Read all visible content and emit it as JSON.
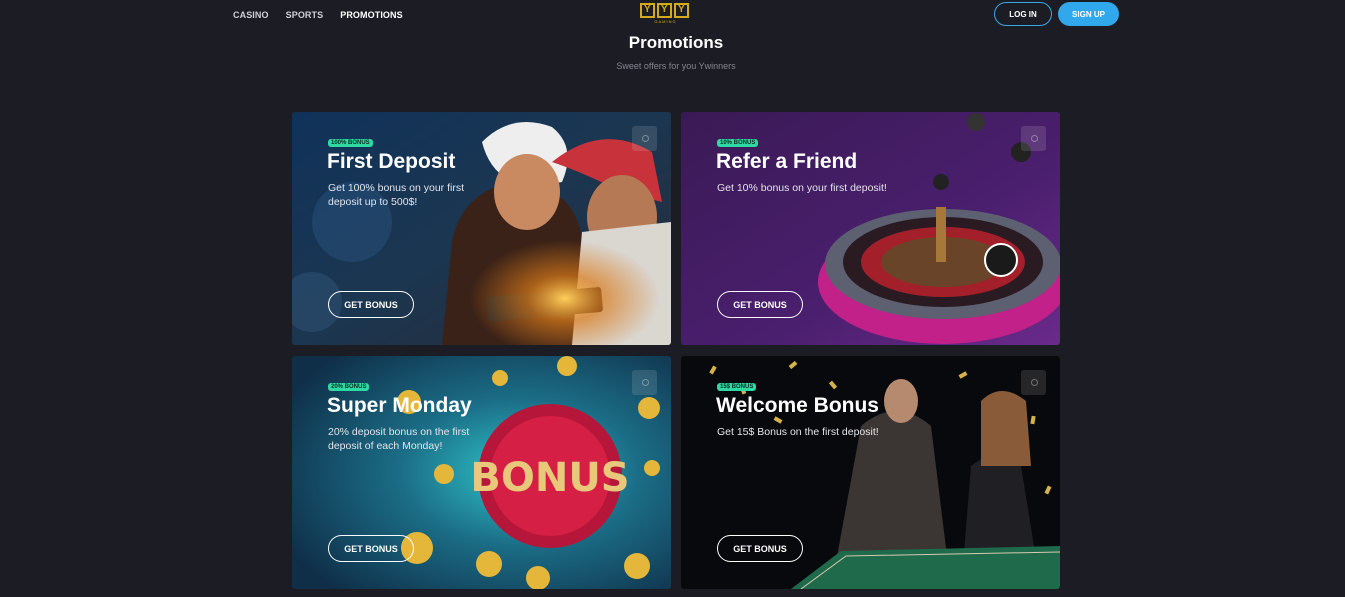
{
  "nav": {
    "casino": "CASINO",
    "sports": "SPORTS",
    "promotions": "PROMOTIONS"
  },
  "logo": {
    "sub": "GAMING"
  },
  "auth": {
    "login": "LOG IN",
    "signup": "SIGN UP"
  },
  "header": {
    "title": "Promotions",
    "subtitle": "Sweet offers for you Ywinners"
  },
  "cards": [
    {
      "badge": "100% BONUS",
      "title": "First Deposit",
      "desc": "Get 100% bonus on your first deposit up to 500$!",
      "button": "GET BONUS"
    },
    {
      "badge": "10% BONUS",
      "title": "Refer a Friend",
      "desc": "Get 10% bonus on your first deposit!",
      "button": "GET BONUS"
    },
    {
      "badge": "20% BONUS",
      "title": "Super Monday",
      "desc": "20% deposit bonus on the first deposit of each Monday!",
      "button": "GET BONUS"
    },
    {
      "badge": "15$ BONUS",
      "title": "Welcome Bonus",
      "desc": "Get 15$ Bonus on the first deposit!",
      "button": "GET BONUS"
    }
  ],
  "bonus_sign_text": "BONUS",
  "colors": {
    "accent": "#31a8eb",
    "badge": "#2ed9a3",
    "logo": "#d4ab1c",
    "background": "#1c1d24"
  }
}
